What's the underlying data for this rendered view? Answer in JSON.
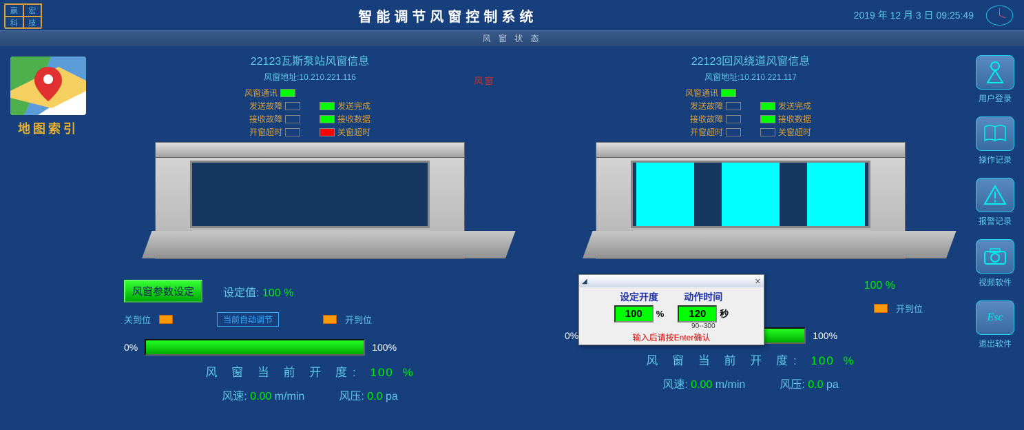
{
  "header": {
    "logo": [
      "赢",
      "宏",
      "科",
      "技"
    ],
    "title": "智能调节风窗控制系统",
    "datetime": "2019 年 12 月 3 日 09:25:49"
  },
  "status_bar": "风 窗 状 态",
  "map_index_label": "地图索引",
  "center_label": "风窗",
  "status_labels": {
    "comm": "风窗通讯",
    "send_fault": "发送故障",
    "send_done": "发送完成",
    "recv_fault": "接收故障",
    "recv_data": "接收数据",
    "open_to": "开窗超时",
    "close_to": "关窗超时"
  },
  "left": {
    "title": "22123瓦斯泵站风窗信息",
    "addr_label": "风窗地址:",
    "addr": "10.210.221.116",
    "param_btn": "风窗参数设定",
    "setval_label": "设定值:",
    "setval": "100",
    "setval_unit": "%",
    "closed_label": "关到位",
    "mode": "当前自动调节",
    "open_label": "开到位",
    "pct0": "0%",
    "pct100": "100%",
    "opening_label": "风 窗 当 前 开 度:",
    "opening": "100",
    "opening_unit": "%",
    "speed_label": "风速:",
    "speed": "0.00",
    "speed_unit": "m/min",
    "press_label": "风压:",
    "press": "0.0",
    "press_unit": "pa"
  },
  "right": {
    "title": "22123回风绕道风窗信息",
    "addr_label": "风窗地址:",
    "addr": "10.210.221.117",
    "setval": "100",
    "setval_unit": "%",
    "open_label": "开到位",
    "pct0": "0%",
    "pct100": "100%",
    "opening_label": "风 窗 当 前 开 度:",
    "opening": "100",
    "opening_unit": "%",
    "speed_label": "风速:",
    "speed": "0.00",
    "speed_unit": "m/min",
    "press_label": "风压:",
    "press": "0.0",
    "press_unit": "pa"
  },
  "popup": {
    "h1": "设定开度",
    "v1": "100",
    "u1": "%",
    "h2": "动作时间",
    "v2": "120",
    "u2": "秒",
    "note": "90--300",
    "foot": "输入后请按Enter确认"
  },
  "sidebar": [
    {
      "label": "用户登录"
    },
    {
      "label": "操作记录"
    },
    {
      "label": "报警记录"
    },
    {
      "label": "视频软件"
    },
    {
      "label": "退出软件"
    }
  ]
}
